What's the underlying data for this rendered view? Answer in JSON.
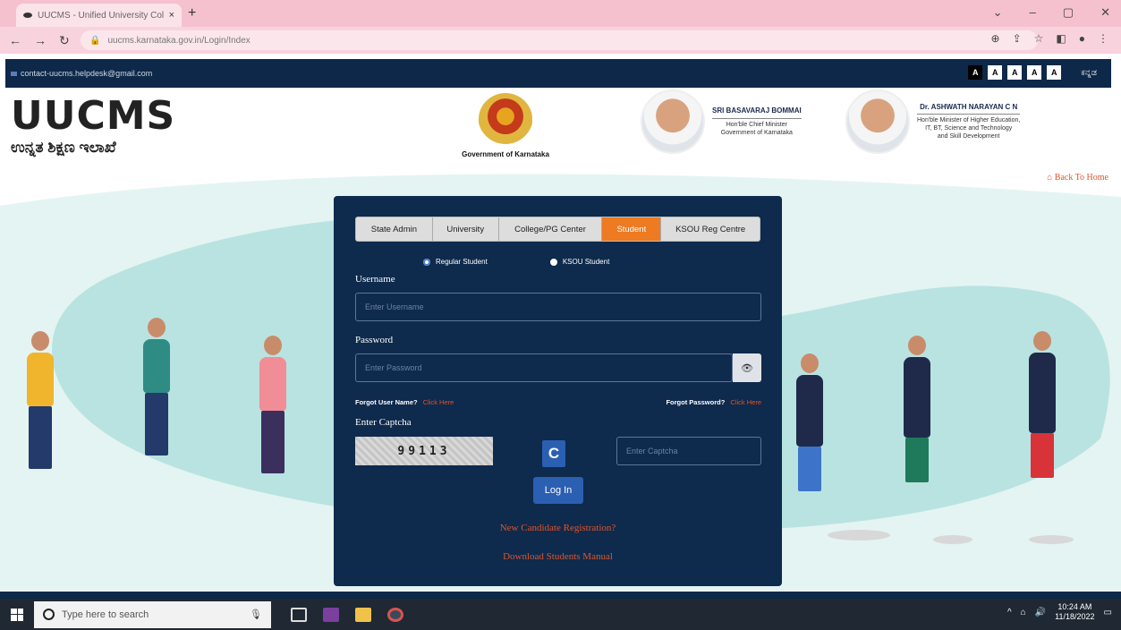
{
  "browser": {
    "tab_title": "UUCMS - Unified University Col",
    "tab_close": "×",
    "new_tab": "+",
    "url": "uucms.karnataka.gov.in/Login/Index",
    "min": "⌄",
    "minimize": "–",
    "maximize": "▢",
    "close": "✕"
  },
  "sitebar": {
    "email": "contact-uucms.helpdesk@gmail.com",
    "font_buttons": [
      "A",
      "A",
      "A",
      "A",
      "A"
    ],
    "language": "ಕನ್ನಡ"
  },
  "header": {
    "logo_text": "UUCMS",
    "logo_sub": "ಉನ್ನತ ಶಿಕ್ಷಣ ಇಲಾಖೆ",
    "emblem_label": "Government of Karnataka",
    "person1": {
      "name": "SRI BASAVARAJ BOMMAI",
      "line1": "Hon'ble Chief Minister",
      "line2": "Government of Karnataka"
    },
    "person2": {
      "name": "Dr. ASHWATH NARAYAN C N",
      "line1": "Hon'ble Minister of Higher Education,",
      "line2": "IT, BT, Science and Technology",
      "line3": "and Skill Development"
    },
    "back_home": "Back To Home"
  },
  "login": {
    "tabs": [
      "State Admin",
      "University",
      "College/PG Center",
      "Student",
      "KSOU Reg Centre"
    ],
    "active_tab": "Student",
    "radio_regular": "Regular Student",
    "radio_ksou": "KSOU Student",
    "username_label": "Username",
    "username_placeholder": "Enter Username",
    "password_label": "Password",
    "password_placeholder": "Enter Password",
    "forgot_user": "Forgot User Name?",
    "forgot_pass": "Forgot Password?",
    "click_here": "Click Here",
    "captcha_label": "Enter Captcha",
    "captcha_value": "99113",
    "captcha_placeholder": "Enter Captcha",
    "login_button": "Log In",
    "new_registration": "New Candidate Registration?",
    "download_manual": "Download Students Manual"
  },
  "taskbar": {
    "search_placeholder": "Type here to search",
    "time": "10:24 AM",
    "date": "11/18/2022"
  }
}
